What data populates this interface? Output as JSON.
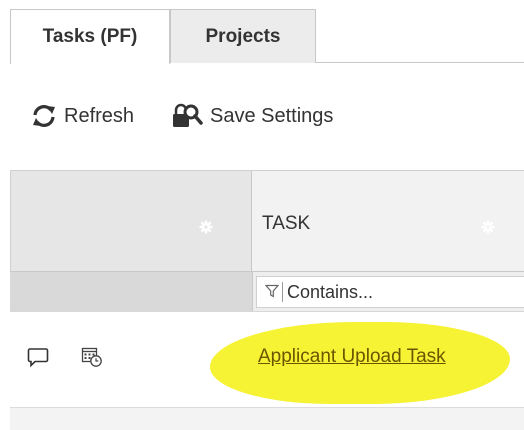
{
  "tabs": [
    {
      "label": "Tasks (PF)",
      "active": true
    },
    {
      "label": "Projects",
      "active": false
    }
  ],
  "toolbar": {
    "refresh_label": "Refresh",
    "save_settings_label": "Save Settings"
  },
  "grid": {
    "columns": [
      {
        "label": ""
      },
      {
        "label": "TASK"
      }
    ],
    "filter": {
      "placeholder": "Contains..."
    },
    "rows": [
      {
        "task": "Applicant Upload Task"
      }
    ]
  },
  "colors": {
    "highlight": "#f6f22a",
    "header_bg": "#e6e6e6",
    "border": "#c8c8c8"
  }
}
